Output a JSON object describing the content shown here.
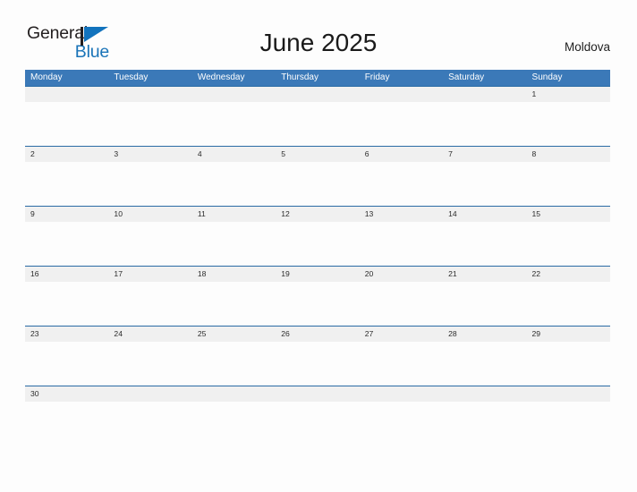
{
  "brand": {
    "name_line1": "General",
    "name_line2": "Blue",
    "flag_icon": "blue-flag-icon",
    "color_dark": "#231f20",
    "color_blue": "#1a74b8"
  },
  "header": {
    "title": "June 2025",
    "locale": "Moldova"
  },
  "calendar": {
    "accent_header_color": "#3b79b8",
    "row_line_color": "#2a6ba5",
    "band_color": "#f0f0f0",
    "day_names": [
      "Monday",
      "Tuesday",
      "Wednesday",
      "Thursday",
      "Friday",
      "Saturday",
      "Sunday"
    ],
    "weeks": [
      [
        "",
        "",
        "",
        "",
        "",
        "",
        "1"
      ],
      [
        "2",
        "3",
        "4",
        "5",
        "6",
        "7",
        "8"
      ],
      [
        "9",
        "10",
        "11",
        "12",
        "13",
        "14",
        "15"
      ],
      [
        "16",
        "17",
        "18",
        "19",
        "20",
        "21",
        "22"
      ],
      [
        "23",
        "24",
        "25",
        "26",
        "27",
        "28",
        "29"
      ],
      [
        "30",
        "",
        "",
        "",
        "",
        "",
        ""
      ]
    ]
  }
}
